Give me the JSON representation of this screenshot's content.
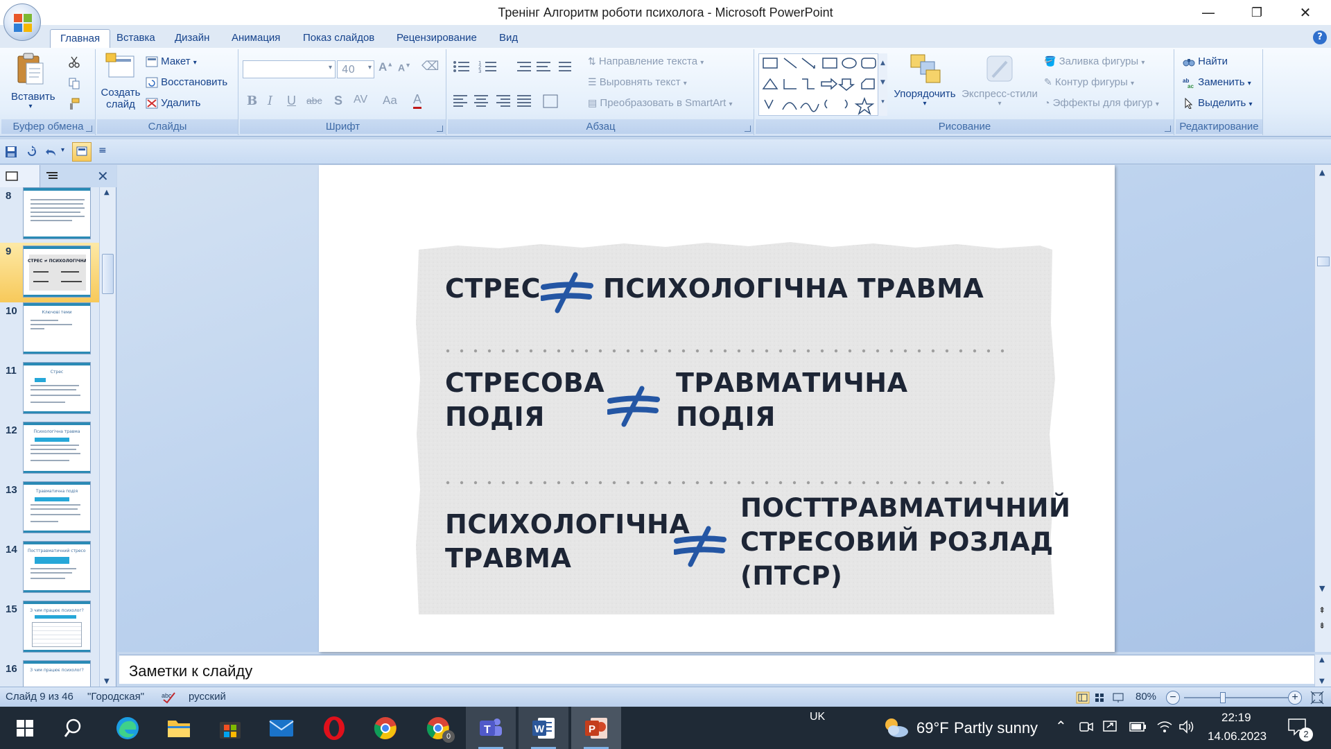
{
  "window": {
    "title": "Тренінг Алгоритм роботи психолога - Microsoft PowerPoint",
    "minimize": "—",
    "restore": "❐",
    "close": "✕"
  },
  "tabs": [
    "Главная",
    "Вставка",
    "Дизайн",
    "Анимация",
    "Показ слайдов",
    "Рецензирование",
    "Вид"
  ],
  "ribbon": {
    "clipboard": {
      "label": "Буфер обмена",
      "paste": "Вставить"
    },
    "slides": {
      "label": "Слайды",
      "new_slide_1": "Создать",
      "new_slide_2": "слайд",
      "layout": "Макет",
      "reset": "Восстановить",
      "delete": "Удалить"
    },
    "font": {
      "label": "Шрифт",
      "size": "40"
    },
    "paragraph": {
      "label": "Абзац",
      "text_direction": "Направление текста",
      "align_text": "Выровнять текст",
      "smartart": "Преобразовать в SmartArt"
    },
    "drawing": {
      "label": "Рисование",
      "arrange": "Упорядочить",
      "quick_styles": "Экспресс-стили",
      "shape_fill": "Заливка фигуры",
      "shape_outline": "Контур фигуры",
      "shape_effects": "Эффекты для фигур"
    },
    "editing": {
      "label": "Редактирование",
      "find": "Найти",
      "replace": "Заменить",
      "select": "Выделить"
    }
  },
  "thumbnails": [
    {
      "num": "8",
      "title": ""
    },
    {
      "num": "9",
      "title": "СТРЕС ≠ ПСИХОЛОГІЧНА ТРАВМА"
    },
    {
      "num": "10",
      "title": "Ключові теми"
    },
    {
      "num": "11",
      "title": "Стрес"
    },
    {
      "num": "12",
      "title": "Психологічна травма"
    },
    {
      "num": "13",
      "title": "Травматична подія"
    },
    {
      "num": "14",
      "title": "Посттравматичний стресовий розлад"
    },
    {
      "num": "15",
      "title": "З чим працює психолог?"
    },
    {
      "num": "16",
      "title": "З чим працює психолог?"
    }
  ],
  "slide": {
    "row1_left": "СТРЕС",
    "row1_right": "ПСИХОЛОГІЧНА ТРАВМА",
    "row2_left_1": "СТРЕСОВА",
    "row2_left_2": "ПОДІЯ",
    "row2_right_1": "ТРАВМАТИЧНА",
    "row2_right_2": "ПОДІЯ",
    "row3_left_1": "ПСИХОЛОГІЧНА",
    "row3_left_2": "ТРАВМА",
    "row3_right_1": "ПОСТТРАВМАТИЧНИЙ",
    "row3_right_2": "СТРЕСОВИЙ РОЗЛАД",
    "row3_right_3": "(ПТСР)"
  },
  "notes": {
    "placeholder": "Заметки к слайду"
  },
  "status": {
    "slide_counter": "Слайд 9 из 46",
    "theme": "\"Городская\"",
    "language": "русский",
    "zoom": "80%"
  },
  "taskbar": {
    "lang": "UK",
    "weather_temp": "69°F",
    "weather_text": "Partly sunny",
    "time": "22:19",
    "date": "14.06.2023",
    "notif_count": "2",
    "chrome_badge": "0"
  },
  "colors": {
    "ribbon_text": "#15428b",
    "ne_sign": "#2456a4",
    "slide_text": "#1d2535",
    "taskbar": "#1f2a36"
  }
}
